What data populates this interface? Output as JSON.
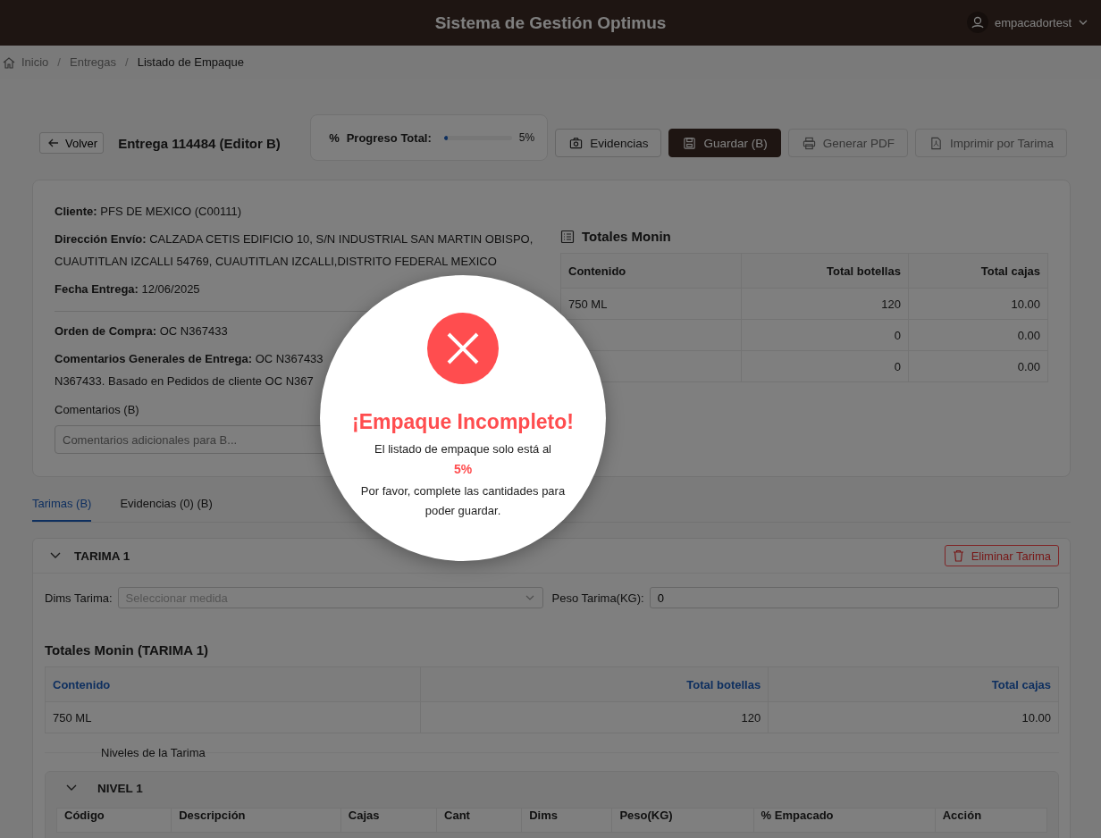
{
  "header": {
    "title": "Sistema de Gestión Optimus",
    "user": "empacadortest"
  },
  "breadcrumb": [
    {
      "label": "Inicio",
      "current": false
    },
    {
      "separator": "/",
      "label": "Entregas",
      "current": false
    },
    {
      "separator": "/",
      "label": "Listado de Empaque",
      "current": true
    }
  ],
  "toolbar": {
    "back": "Volver",
    "title": "Entrega 114484 (Editor B)",
    "progress": {
      "symbol": "%",
      "label": "Progreso Total:",
      "level": 0.05,
      "reading": "5%"
    },
    "buttons": [
      {
        "label": "Evidencias",
        "kind": "default",
        "disabled": false
      },
      {
        "label": "Guardar (B)",
        "kind": "primary",
        "disabled": false
      },
      {
        "label": "Generar PDF",
        "kind": "default",
        "disabled": true
      },
      {
        "label": "Imprimir por Tarima",
        "kind": "default",
        "disabled": true
      }
    ]
  },
  "info": {
    "fields": [
      {
        "label": "Cliente:",
        "value": "PFS DE MEXICO (C00111)"
      },
      {
        "label": "Dirección Envío:",
        "value": "CALZADA CETIS EDIFICIO 10, S/N INDUSTRIAL SAN MARTIN OBISPO, CUAUTITLAN IZCALLI 54769, CUAUTITLAN IZCALLI,DISTRITO FEDERAL MEXICO"
      },
      {
        "label": "Fecha Entrega:",
        "value": "12/06/2025"
      }
    ],
    "fields_2": [
      {
        "label": "Orden de Compra:",
        "value": "OC N367433"
      },
      {
        "label": "Comentarios Generales de Entrega:",
        "value": "OC N367433",
        "value_2": "N367433. Basado en Pedidos de cliente OC N367"
      }
    ],
    "comments": {
      "label": "Comentarios (B)",
      "placeholder": "Comentarios adicionales para B..."
    },
    "totals": {
      "title": "Totales Monin",
      "columns": [
        "Contenido",
        "Total botellas",
        "Total cajas"
      ],
      "rows": [
        [
          "750 ML",
          "120",
          "10.00"
        ],
        [
          "",
          "0",
          "0.00"
        ],
        [
          "",
          "0",
          "0.00"
        ]
      ]
    }
  },
  "tabs": [
    {
      "label": "Tarimas (B)",
      "selected": true
    },
    {
      "label": "Evidencias (0) (B)",
      "selected": false
    }
  ],
  "tarima": {
    "title": "TARIMA 1",
    "expanded": true,
    "delete": "Eliminar Tarima",
    "dims": {
      "label": "Dims Tarima:",
      "placeholder": "Seleccionar medida"
    },
    "weight": {
      "label": "Peso Tarima(KG):",
      "value": "0"
    },
    "totals": {
      "title": "Totales Monin (TARIMA 1)",
      "columns": [
        "Contenido",
        "Total botellas",
        "Total cajas"
      ],
      "rows": [
        [
          "750 ML",
          "120",
          "10.00"
        ]
      ]
    },
    "levels_title": "Niveles de la Tarima",
    "level": {
      "title": "NIVEL 1",
      "expanded": true,
      "columns": [
        "Código",
        "Descripción",
        "Cajas",
        "Cant",
        "Dims",
        "Peso(KG)",
        "% Empacado",
        "Acción"
      ]
    }
  },
  "modal": {
    "title": "¡Empaque Incompleto!",
    "text": "El listado de empaque solo está al",
    "percent": "5%",
    "text_2": "Por favor, complete las cantidades para poder guardar."
  }
}
